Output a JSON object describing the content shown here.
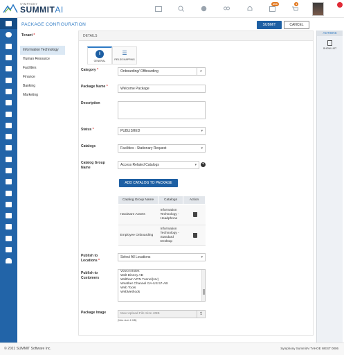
{
  "brand": {
    "small": "SYMPHONY",
    "name_main": "SUMMIT",
    "name_ai": "AI"
  },
  "topbar": {
    "badges": {
      "notifications": "104",
      "cart": "1"
    }
  },
  "header": {
    "title": "PACKAGE CONFIGURATION",
    "submit_label": "SUBMIT",
    "cancel_label": "CANCEL"
  },
  "actions": {
    "title": "ACTIONS",
    "show_list_label": "SHOW LIST"
  },
  "tenant": {
    "label": "Tenant",
    "items": [
      "Information Technology",
      "Human Resource",
      "Facilities",
      "Finance",
      "Banking",
      "Marketing"
    ],
    "selected": "Information Technology"
  },
  "details": {
    "section_title": "DETAILS",
    "tabs": [
      {
        "label": "GENERAL",
        "active": true
      },
      {
        "label": "FIELDS MAPPING",
        "active": false
      }
    ]
  },
  "form": {
    "category_label": "Category",
    "category_value": "Onboarding/ Offboarding",
    "package_name_label": "Package Name",
    "package_name_value": "Welcome Package",
    "description_label": "Description",
    "status_label": "Status",
    "status_value": "PUBLISHED",
    "catalogs_label": "Catalogs",
    "catalogs_value": "Facilities - Stationary Request",
    "catalog_group_label": "Catalog Group Name",
    "catalog_group_value": "Access Related Catalogs",
    "add_button_label": "ADD CATALOG TO PACKAGE",
    "table_headers": [
      "Catalog Group Name",
      "Catalogs",
      "Action"
    ],
    "table_rows": [
      {
        "group": "Hardware Assets",
        "catalog": "Information Technology - Headphone"
      },
      {
        "group": "Employee Onboarding",
        "catalog": "Information Technology - Standard Desktop"
      }
    ],
    "publish_locations_label": "Publish to Locations",
    "publish_locations_value": "Select All Locations",
    "publish_customers_label": "Publish to Customers",
    "customers": [
      "Volvo Infotek",
      "Walt Disney AB",
      "Waltham VPN Tunnel(srv)",
      "Weather Channel GA-US 57-AB",
      "Web Tools",
      "WebMethods"
    ],
    "package_image_label": "Package Image",
    "upload_placeholder": "Max Upload File Size 4MB",
    "upload_hint": "(Max size 4 MB)"
  },
  "footer": {
    "copyright": "© 2021 SUMMIT Software Inc.",
    "version": "Symphony SummitAI TAHOE WEST 0006"
  }
}
